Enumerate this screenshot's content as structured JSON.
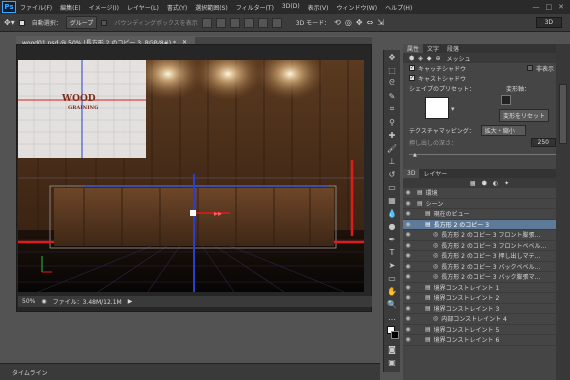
{
  "app": {
    "logo": "Ps"
  },
  "menu": [
    "ファイル(F)",
    "編集(E)",
    "イメージ(I)",
    "レイヤー(L)",
    "書式(Y)",
    "選択範囲(S)",
    "フィルター(T)",
    "3D(D)",
    "表示(V)",
    "ウィンドウ(W)",
    "ヘルプ(H)"
  ],
  "options": {
    "auto_select_label": "自動選択：",
    "auto_select_value": "グループ",
    "bbox_label": "バウンディングボックスを表示",
    "mode3d_label": "3D モード：",
    "mode_value": "3D"
  },
  "document": {
    "tab_title": "wood01.psd @ 50% (長方形 2 のコピー 3, RGB/8#) *",
    "wood_title": "WOOD",
    "wood_subtitle": "GRAINING"
  },
  "status": {
    "zoom": "50%",
    "file_info": "ファイル：3.48M/12.1M"
  },
  "timeline": {
    "label": "タイムライン"
  },
  "properties": {
    "tabs": [
      "属性",
      "文字",
      "段落"
    ],
    "mesh_label": "メッシュ",
    "catch_shadow": "キャッチシャドウ",
    "cast_shadow": "キャストシャドウ",
    "invisible": "非表示",
    "shape_preset": "シェイプのプリセット：",
    "deform_axis": "変形軸：",
    "reset_deform": "変形をリセット",
    "texture_mapping": "テクスチャマッピング：",
    "texture_value": "拡大・縮小",
    "extrude_depth": "押し出しの深さ：",
    "extrude_value": "250"
  },
  "layers": {
    "tabs": [
      "3D",
      "レイヤー"
    ],
    "items": [
      {
        "label": "環境",
        "indent": 0,
        "sel": false
      },
      {
        "label": "シーン",
        "indent": 0,
        "sel": false
      },
      {
        "label": "現在のビュー",
        "indent": 1,
        "sel": false
      },
      {
        "label": "長方形 2 のコピー 3",
        "indent": 1,
        "sel": true
      },
      {
        "label": "長方形 2 のコピー 3 フロント膨張...",
        "indent": 2,
        "sel": false
      },
      {
        "label": "長方形 2 のコピー 3 フロントベベル...",
        "indent": 2,
        "sel": false
      },
      {
        "label": "長方形 2 のコピー 3 押し出しマテ...",
        "indent": 2,
        "sel": false
      },
      {
        "label": "長方形 2 のコピー 3 バックベベル...",
        "indent": 2,
        "sel": false
      },
      {
        "label": "長方形 2 のコピー 3 バック膨張マ...",
        "indent": 2,
        "sel": false
      },
      {
        "label": "境界コンストレイント 1",
        "indent": 1,
        "sel": false
      },
      {
        "label": "境界コンストレイント 2",
        "indent": 1,
        "sel": false
      },
      {
        "label": "境界コンストレイント 3",
        "indent": 1,
        "sel": false
      },
      {
        "label": "内部コンストレイント 4",
        "indent": 2,
        "sel": false
      },
      {
        "label": "境界コンストレイント 5",
        "indent": 1,
        "sel": false
      },
      {
        "label": "境界コンストレイント 6",
        "indent": 1,
        "sel": false
      }
    ]
  },
  "colors": {
    "accent": "#5d7a98",
    "wood": "#6b4527",
    "axis_red": "#e01b1b",
    "axis_blue": "#2a3fd0"
  }
}
